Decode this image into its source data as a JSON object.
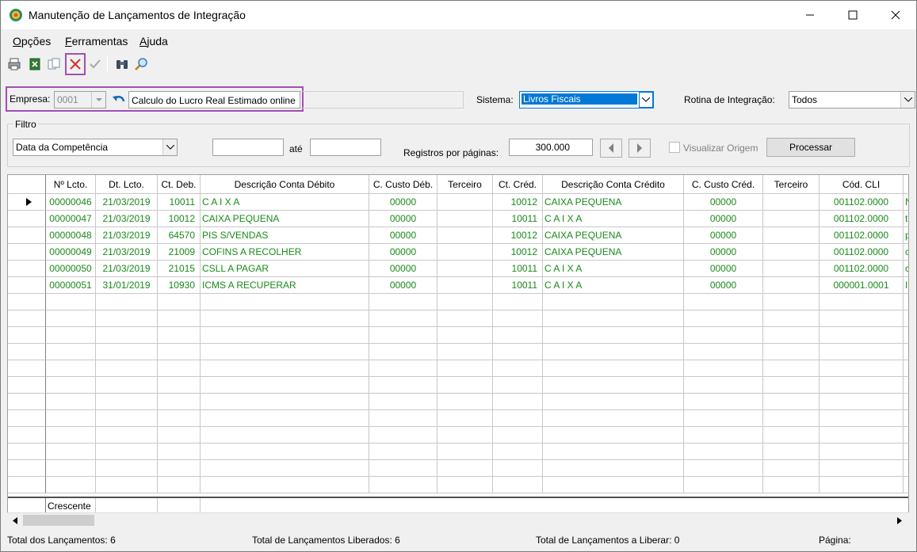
{
  "window": {
    "title": "Manutenção de Lançamentos de Integração"
  },
  "menu": [
    {
      "accel": "O",
      "rest": "pções"
    },
    {
      "accel": "F",
      "rest": "erramentas"
    },
    {
      "accel": "A",
      "rest": "juda"
    }
  ],
  "toolbar": {
    "icons": [
      "printer-icon",
      "excel-export-icon",
      "copy-icon",
      "cancel-x-icon",
      "confirm-check-icon",
      "binoculars-icon",
      "magnifier-icon"
    ]
  },
  "empresa": {
    "label": "Empresa:",
    "code": "0001",
    "name": "Calculo do Lucro Real Estimado online"
  },
  "sistema": {
    "label": "Sistema:",
    "value": "Livros Fiscais"
  },
  "rotina": {
    "label": "Rotina de Integração:",
    "value": "Todos"
  },
  "filtro": {
    "title": "Filtro",
    "type_value": "Data da Competência",
    "ate": "até",
    "registros_label": "Registros por páginas:",
    "registros_value": "300.000",
    "visualizar_label": "Visualizar Origem",
    "processar_label": "Processar"
  },
  "grid": {
    "columns": [
      "Nº Lcto.",
      "Dt. Lcto.",
      "Ct. Deb.",
      "Descrição Conta Débito",
      "C. Custo Déb.",
      "Terceiro",
      "Ct. Créd.",
      "Descrição Conta Crédito",
      "C. Custo Créd.",
      "Terceiro",
      "Cód. CLI"
    ],
    "rows": [
      [
        "00000046",
        "21/03/2019",
        "10011",
        "C A I X A",
        "00000",
        "",
        "10012",
        "CAIXA PEQUENA",
        "00000",
        "",
        "001102.0000",
        "N"
      ],
      [
        "00000047",
        "21/03/2019",
        "10012",
        "CAIXA PEQUENA",
        "00000",
        "",
        "10011",
        "C A I X A",
        "00000",
        "",
        "001102.0000",
        "t"
      ],
      [
        "00000048",
        "21/03/2019",
        "64570",
        "PIS S/VENDAS",
        "00000",
        "",
        "10012",
        "CAIXA PEQUENA",
        "00000",
        "",
        "001102.0000",
        "p"
      ],
      [
        "00000049",
        "21/03/2019",
        "21009",
        "COFINS A RECOLHER",
        "00000",
        "",
        "10012",
        "CAIXA PEQUENA",
        "00000",
        "",
        "001102.0000",
        "c"
      ],
      [
        "00000050",
        "21/03/2019",
        "21015",
        "CSLL A PAGAR",
        "00000",
        "",
        "10011",
        "C A I X A",
        "00000",
        "",
        "001102.0000",
        "c"
      ],
      [
        "00000051",
        "31/01/2019",
        "10930",
        "ICMS A RECUPERAR",
        "00000",
        "",
        "10011",
        "C A I X A",
        "00000",
        "",
        "000001.0001",
        "I"
      ]
    ],
    "footer": "Crescente"
  },
  "status": {
    "total": "Total dos Lançamentos: 6",
    "liberados": "Total de Lançamentos Liberados: 6",
    "a_liberar": "Total de Lançamentos a Liberar: 0",
    "pagina": "Página:"
  },
  "colors": {
    "accent_highlight": "#a14fb3",
    "row_text": "#1a8a1a",
    "selection": "#0078d7"
  }
}
